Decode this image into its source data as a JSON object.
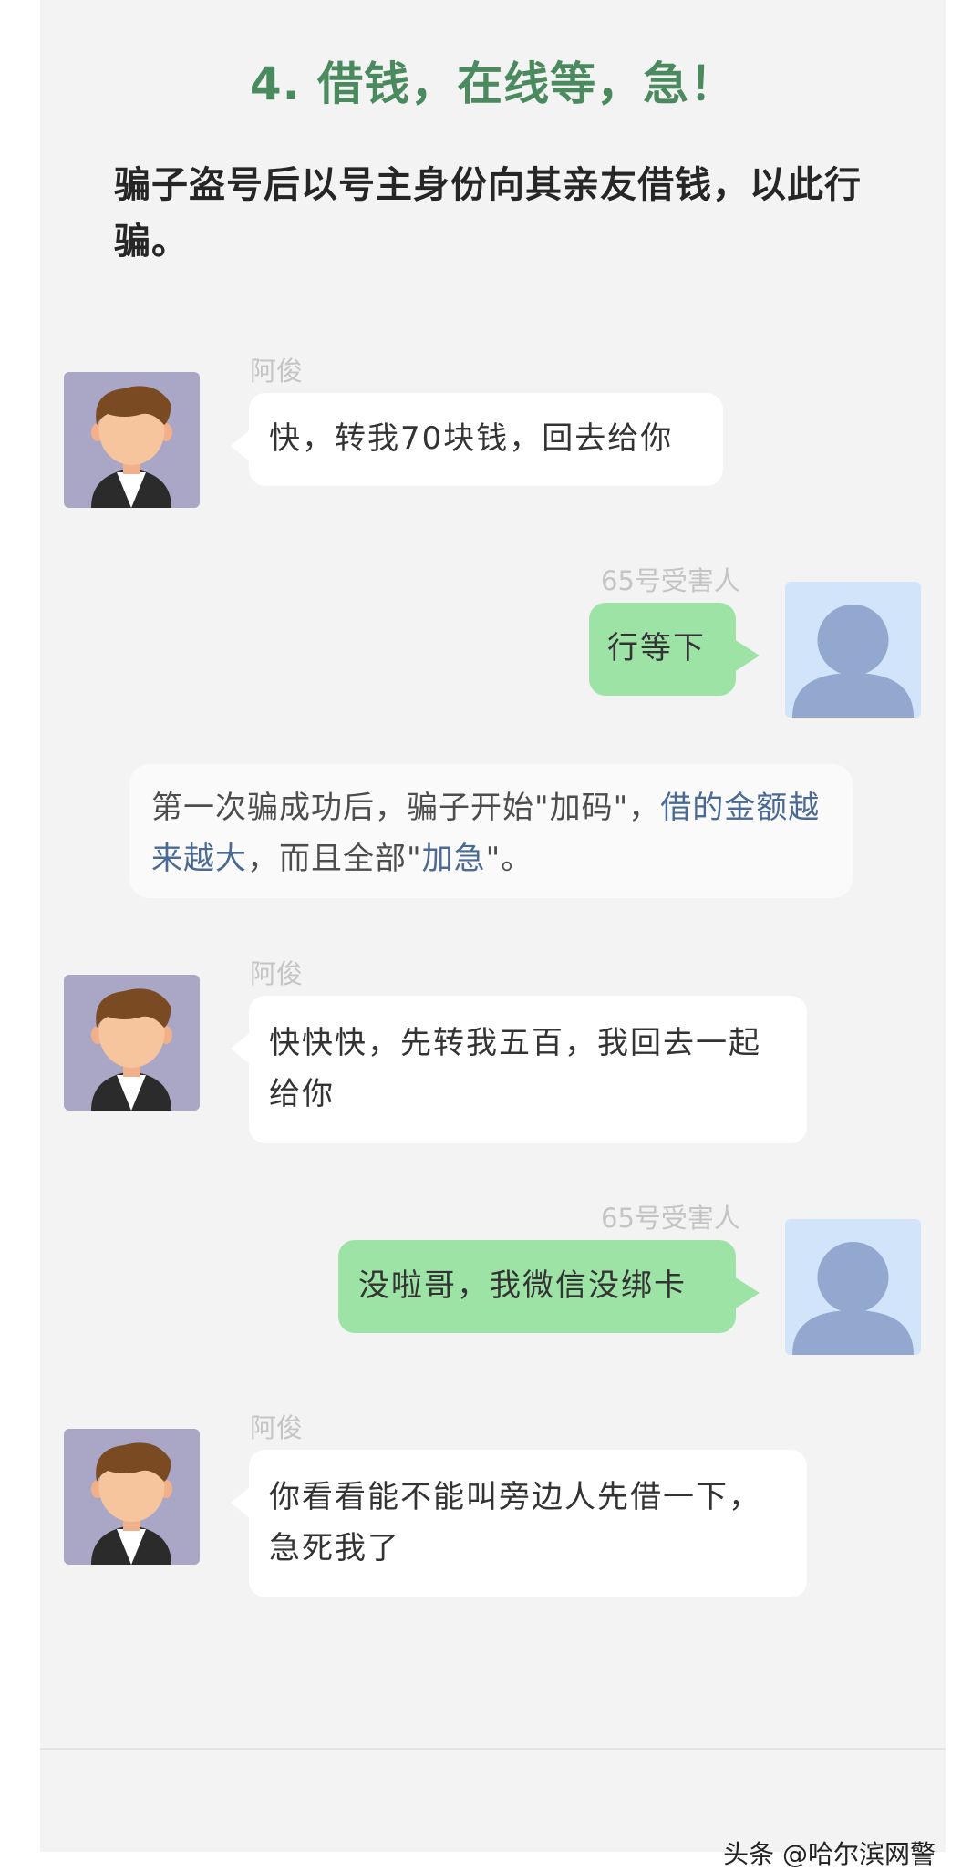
{
  "section": {
    "heading": "4. 借钱，在线等，急！",
    "intro": "骗子盗号后以号主身份向其亲友借钱，以此行骗。"
  },
  "messages": [
    {
      "side": "left",
      "sender": "阿俊",
      "text": "快，转我70块钱，回去给你"
    },
    {
      "side": "right",
      "sender": "65号受害人",
      "text": "行等下"
    },
    {
      "side": "left",
      "sender": "阿俊",
      "text": "快快快，先转我五百，我回去一起给你"
    },
    {
      "side": "right",
      "sender": "65号受害人",
      "text": "没啦哥，我微信没绑卡"
    },
    {
      "side": "left",
      "sender": "阿俊",
      "text": "你看看能不能叫旁边人先借一下，急死我了"
    }
  ],
  "note": {
    "part1": "第一次骗成功后，骗子开始\"加码\"，",
    "highlight1": "借的金额越来越大",
    "part2": "，而且全部\"",
    "highlight2": "加急",
    "part3": "\"。"
  },
  "footer": {
    "watermark": "头条 @哈尔滨网警"
  },
  "colors": {
    "heading": "#4b8a5f",
    "bubble_right": "#9de3a6",
    "bubble_left": "#ffffff",
    "highlight": "#4a6a94",
    "panel_bg": "#f3f3f3"
  }
}
